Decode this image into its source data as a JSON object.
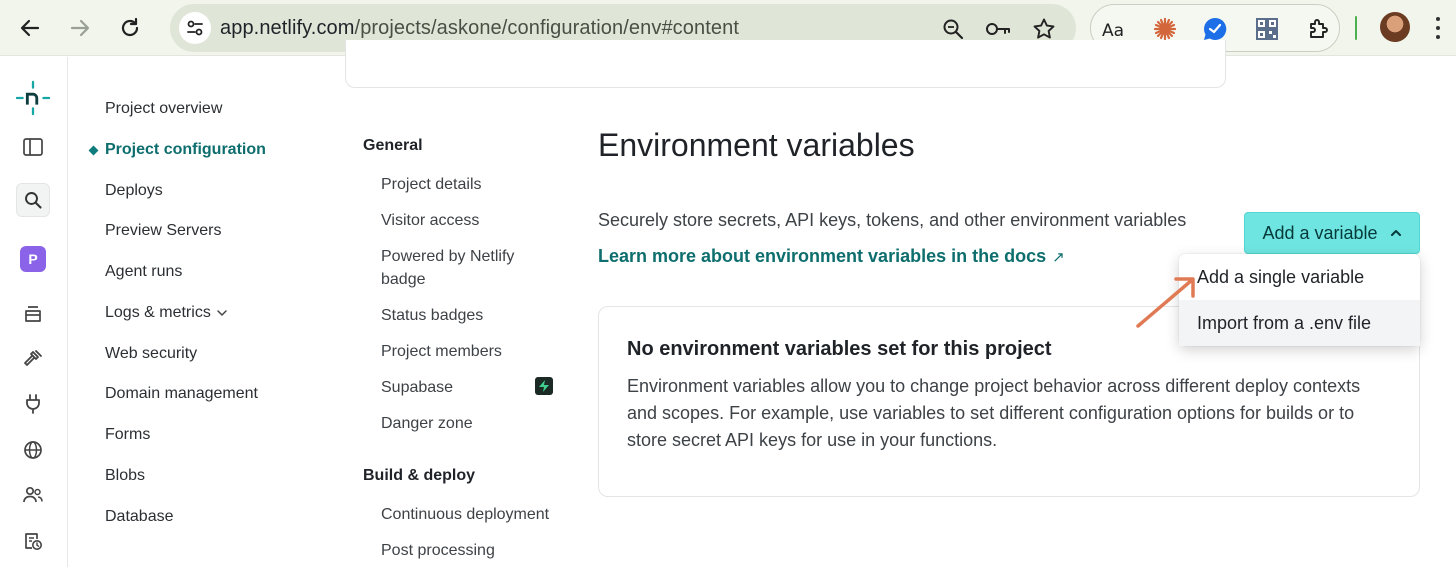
{
  "browser": {
    "url_host": "app.netlify.com",
    "url_path": "/projects/askone/configuration/env#content"
  },
  "rail": {
    "workspace_badge": "P"
  },
  "left_nav": {
    "items": [
      {
        "label": "Project overview"
      },
      {
        "label": "Project configuration",
        "active": true
      },
      {
        "label": "Deploys"
      },
      {
        "label": "Preview Servers"
      },
      {
        "label": "Agent runs"
      },
      {
        "label": "Logs & metrics",
        "has_submenu": true
      },
      {
        "label": "Web security"
      },
      {
        "label": "Domain management"
      },
      {
        "label": "Forms"
      },
      {
        "label": "Blobs"
      },
      {
        "label": "Database"
      }
    ]
  },
  "sub_nav": {
    "general_heading": "General",
    "general_items": [
      "Project details",
      "Visitor access",
      "Powered by Netlify badge",
      "Status badges",
      "Project members",
      "Supabase",
      "Danger zone"
    ],
    "build_heading": "Build & deploy",
    "build_items": [
      "Continuous deployment",
      "Post processing"
    ]
  },
  "main": {
    "title": "Environment variables",
    "description": "Securely store secrets, API keys, tokens, and other environment variables",
    "docs_link": "Learn more about environment variables in the docs",
    "docs_link_arrow": "↗",
    "add_button": "Add a variable",
    "dropdown": [
      {
        "label": "Add a single variable"
      },
      {
        "label": "Import from a .env file",
        "hovered": true
      }
    ],
    "empty_state": {
      "title": "No environment variables set for this project",
      "body": "Environment variables allow you to change project behavior across different deploy contexts and scopes. For example, use variables to set different configuration options for builds or to store secret API keys for use in your functions."
    }
  },
  "colors": {
    "accent_teal": "#0e6e6e",
    "button_bg": "#6fe5e1",
    "annotation_arrow": "#e07a55",
    "workspace_badge": "#8a63e8"
  }
}
